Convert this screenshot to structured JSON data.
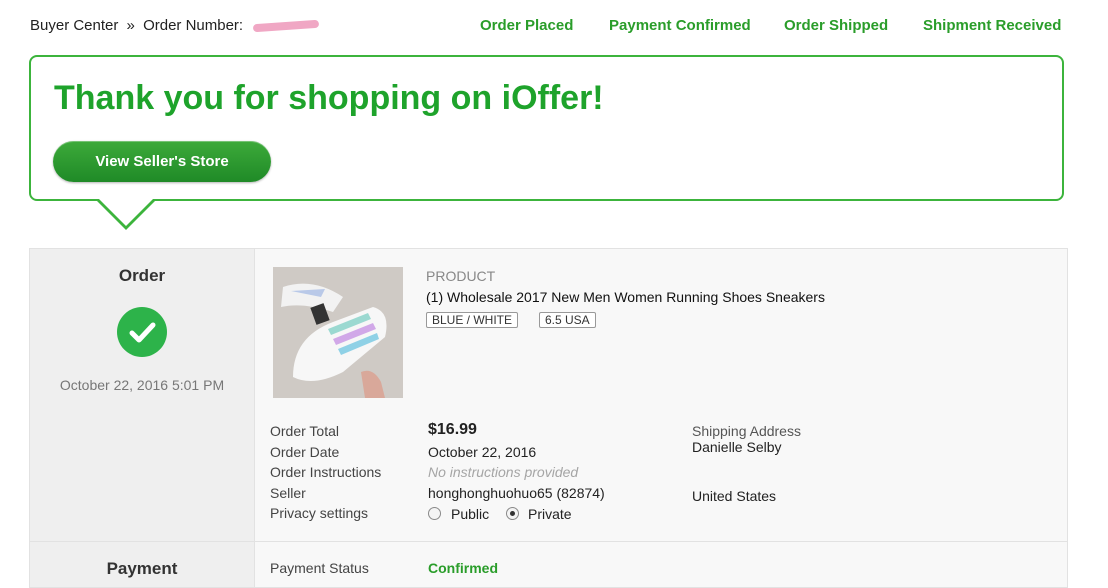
{
  "breadcrumb": {
    "root": "Buyer Center",
    "separator": "»",
    "order_number_label": "Order Number:"
  },
  "steps": [
    "Order Placed",
    "Payment Confirmed",
    "Order Shipped",
    "Shipment Received"
  ],
  "hero": {
    "title": "Thank you for shopping on iOffer!",
    "store_button": "View Seller's Store"
  },
  "order_section": {
    "label": "Order",
    "status_icon": "check-circle-icon",
    "datetime": "October 22, 2016 5:01 PM"
  },
  "product": {
    "kicker": "PRODUCT",
    "quantity": "(1)",
    "title": "Wholesale 2017 New Men Women Running Shoes Sneakers",
    "options": [
      "BLUE / WHITE",
      "6.5 USA"
    ],
    "image_icon": "sneaker-photo"
  },
  "details": {
    "order_total_label": "Order Total",
    "order_total": "$16.99",
    "order_date_label": "Order Date",
    "order_date": "October 22, 2016",
    "instructions_label": "Order Instructions",
    "instructions": "No instructions provided",
    "seller_label": "Seller",
    "seller": "honghonghuohuo65 (82874)",
    "privacy_label": "Privacy settings",
    "privacy_options": [
      "Public",
      "Private"
    ],
    "privacy_selected": "Private"
  },
  "shipping": {
    "label": "Shipping Address",
    "name": "Danielle Selby",
    "country": "United States"
  },
  "payment_section": {
    "label": "Payment",
    "status_label": "Payment Status",
    "status": "Confirmed"
  },
  "colors": {
    "brand_green": "#1ea32b",
    "step_green": "#2a9d2a",
    "check_green": "#2db34a"
  }
}
